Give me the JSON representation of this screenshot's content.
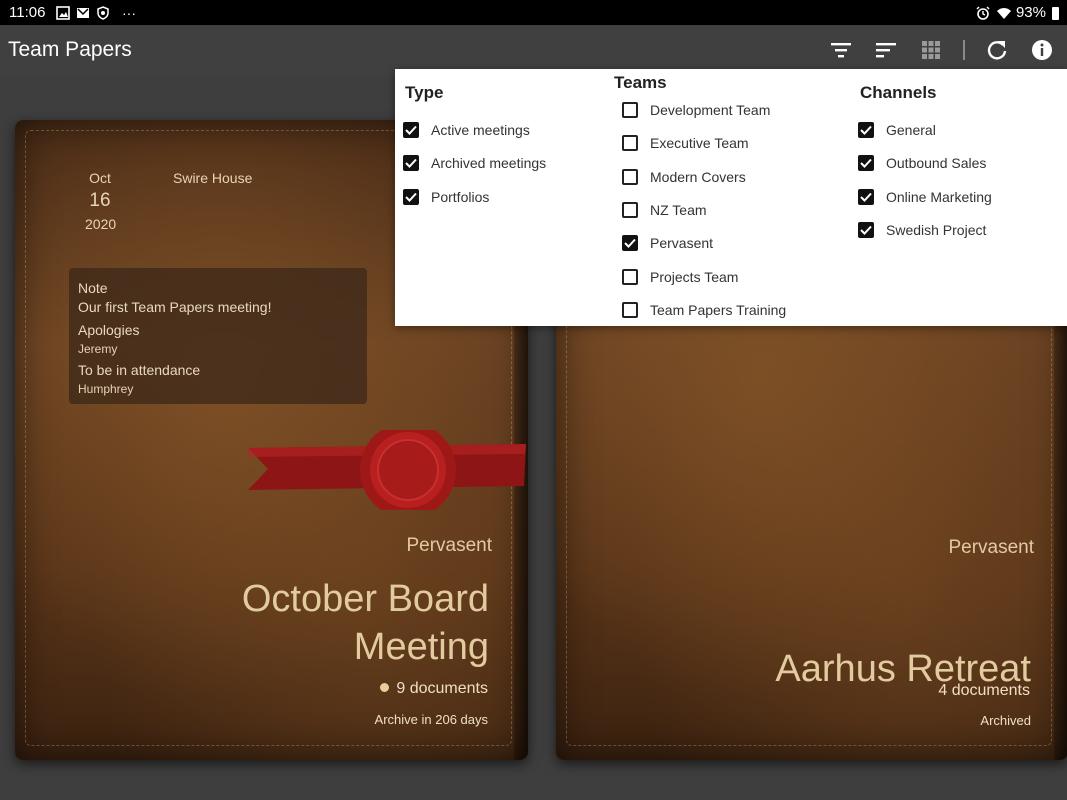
{
  "status_bar": {
    "time": "11:06",
    "overflow": "···",
    "battery": "93%",
    "icons_left": [
      "image-icon",
      "gmail-icon",
      "shield-icon"
    ],
    "icons_right": [
      "alarm-icon",
      "wifi-icon",
      "battery-icon"
    ]
  },
  "app_bar": {
    "title": "Team Papers",
    "actions": [
      "filter-icon",
      "sort-icon",
      "grid-view-icon",
      "refresh-icon",
      "info-icon"
    ]
  },
  "books": [
    {
      "date": {
        "month": "Oct",
        "day": "16",
        "year": "2020"
      },
      "location": "Swire House",
      "note": {
        "note_label": "Note",
        "note_value": "Our first Team Papers meeting!",
        "apologies_label": "Apologies",
        "apologies_value": "Jeremy",
        "attendance_label": "To be in attendance",
        "attendance_value": "Humphrey"
      },
      "team": "Pervasent",
      "title_line1": "October Board",
      "title_line2": "Meeting",
      "documents": "9 documents",
      "status": "Archive in 206 days",
      "has_unread_dot": true
    },
    {
      "team": "Pervasent",
      "title": "Aarhus Retreat",
      "documents": "4 documents",
      "status": "Archived"
    }
  ],
  "filter": {
    "type": {
      "heading": "Type",
      "options": [
        {
          "label": "Active meetings",
          "checked": true
        },
        {
          "label": "Archived meetings",
          "checked": true
        },
        {
          "label": "Portfolios",
          "checked": true
        }
      ]
    },
    "teams": {
      "heading": "Teams",
      "options": [
        {
          "label": "Development Team",
          "checked": false
        },
        {
          "label": "Executive Team",
          "checked": false
        },
        {
          "label": "Modern Covers",
          "checked": false
        },
        {
          "label": "NZ Team",
          "checked": false
        },
        {
          "label": "Pervasent",
          "checked": true
        },
        {
          "label": "Projects Team",
          "checked": false
        },
        {
          "label": "Team Papers Training",
          "checked": false
        }
      ]
    },
    "channels": {
      "heading": "Channels",
      "options": [
        {
          "label": "General",
          "checked": true
        },
        {
          "label": "Outbound Sales",
          "checked": true
        },
        {
          "label": "Online Marketing",
          "checked": true
        },
        {
          "label": "Swedish Project",
          "checked": true
        }
      ]
    }
  },
  "colors": {
    "app_bar": "#404040",
    "background": "#3e3e3e",
    "book_text": "#e3cba0",
    "ribbon": "#a51c1c",
    "seal": "#b81f1f"
  }
}
